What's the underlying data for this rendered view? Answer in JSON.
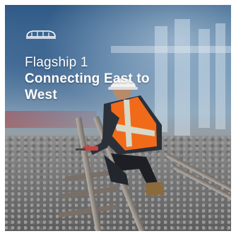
{
  "headline": {
    "line1": "Flagship 1",
    "line2": "Connecting East to",
    "line3": "West"
  },
  "logo": {
    "icon": "train-logo-icon"
  },
  "colors": {
    "text": "#ffffff",
    "sky": "#2f5b86",
    "vest_orange": "#f06a1a",
    "vest_reflective": "#d8d8c8",
    "helmet": "#f2f2f2"
  }
}
